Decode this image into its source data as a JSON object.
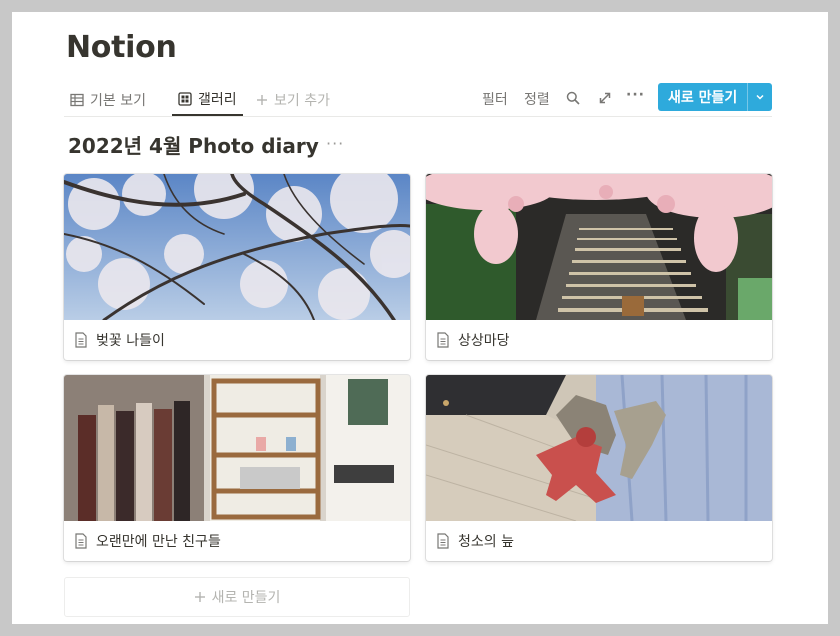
{
  "page": {
    "title": "Notion"
  },
  "views": {
    "tabs": [
      {
        "label": "기본 보기",
        "icon": "table-icon"
      },
      {
        "label": "갤러리",
        "icon": "gallery-icon"
      },
      {
        "label": "보기 추가",
        "icon": "plus-icon"
      }
    ],
    "active_tab": "갤러리"
  },
  "toolbar": {
    "filter": "필터",
    "sort": "정렬",
    "search_icon": "search-icon",
    "expand_icon": "expand-icon",
    "more": "···",
    "new_button": "새로 만들기"
  },
  "database": {
    "title": "2022년 4월 Photo diary",
    "more": "···"
  },
  "cards": [
    {
      "title": "벚꽃 나들이",
      "cover": "cherry blossom branches against blue sky"
    },
    {
      "title": "상상마당",
      "cover": "staircase under pink blossom arch with plants"
    },
    {
      "title": "오랜만에 만난 친구들",
      "cover": "shop with hanging scarves and wooden shelves"
    },
    {
      "title": "청소의 늪",
      "cover": "toy dinosaurs on wooden floor by a curtain"
    }
  ],
  "new_card": {
    "label": "새로 만들기"
  },
  "colors": {
    "accent": "#2eaadc",
    "text": "#37352f",
    "muted": "#787774"
  }
}
